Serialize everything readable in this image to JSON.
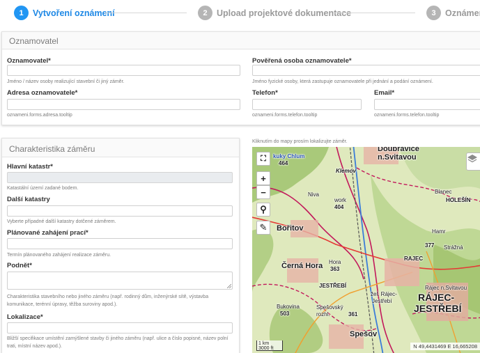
{
  "stepper": {
    "steps": [
      {
        "number": "1",
        "label": "Vytvoření oznámení"
      },
      {
        "number": "2",
        "label": "Upload projektové dokumentace"
      },
      {
        "number": "3",
        "label": "Oznámeno"
      }
    ]
  },
  "oznamovatel": {
    "title": "Oznamovatel",
    "fields": {
      "oznamovatel": {
        "label": "Oznamovatel*",
        "value": "",
        "help": "Jméno / název osoby realizující stavební či jiný záměr."
      },
      "poverena_osoba": {
        "label": "Pověřená osoba oznamovatele*",
        "value": "",
        "help": "Jméno fyzické osoby, která zastupuje oznamovatele při jednání a podání oznámení."
      },
      "adresa": {
        "label": "Adresa oznamovatele*",
        "value": "",
        "help": "oznameni.forms.adresa.tooltip"
      },
      "telefon": {
        "label": "Telefon*",
        "value": "",
        "help": "oznameni.forms.telefon.tooltip"
      },
      "email": {
        "label": "Email*",
        "value": "",
        "help": "oznameni.forms.telefon.tooltip"
      }
    }
  },
  "zamer": {
    "title": "Charakteristika záměru",
    "fields": {
      "hlavni_katastr": {
        "label": "Hlavní katastr*",
        "value": "",
        "help": "Katastální území zadané bodem."
      },
      "dalsi_katastry": {
        "label": "Další katastry",
        "value": "",
        "help": "Vyberte případné další katastry dotčené záměrem."
      },
      "zahajeni": {
        "label": "Plánované zahájení prací*",
        "value": "",
        "help": "Termín plánovaného zahájení realizace záměru."
      },
      "podnet": {
        "label": "Podnět*",
        "value": "",
        "help": "Charakteristika stavebního nebo jiného záměru (např. rodinný dům, inženýrské sítě, výstavba komunikace, terénní úpravy, těžba suroviny apod.)."
      },
      "lokalizace": {
        "label": "Lokalizace*",
        "value": "",
        "help": "Bližší specifikace umístění zamýšlené stavby či jiného záměru (např. ulice a číslo popisné, název polní trati, místní název apod.)."
      }
    }
  },
  "map": {
    "hint": "Kliknutím do mapy prosím lokalizujte záměr.",
    "controls": {
      "fullscreen": "⛶",
      "zoom_in": "+",
      "zoom_out": "−",
      "search": "⚲",
      "draw": "✎"
    },
    "places": {
      "doubravice": "Doubravice",
      "n_svitavou": "n.Svitavou",
      "kuky_chlum": "kuky Chlum",
      "kuky_chlum_num": "464",
      "kiemovi": "Klemov",
      "niva": "Niva",
      "work": "work",
      "n404": "404",
      "blanec": "Blanec",
      "holesin": "HOLEŠÍN",
      "boritov": "Bořitov",
      "cerna_hora": "Černá Hora",
      "hora": "Hora",
      "n363": "363",
      "rajec": "RAJEC",
      "hamr": "Hamr",
      "n377": "377",
      "strazna": "Strážná",
      "jestrebi": "JESTŘEBÍ",
      "rajec_jestrebi_a": "RÁJEC-",
      "rajec_jestrebi_b": "JESTŘEBÍ",
      "rajec_svitavou": "Rájec n.Svitavou",
      "bukovina": "Bukovina",
      "n503": "503",
      "spesovsk": "Spešovský",
      "rozhl": "rozhl.",
      "n361": "361",
      "zel_rajec": "žel. Rájec-",
      "zel_jestrebi": "Jestřebí",
      "spesov": "Spešov"
    },
    "scale_km": "1 km",
    "scale_ft": "3000 ft",
    "coords": "N 49,4431469 E 16,665208"
  },
  "colors": {
    "accent": "#2196f3",
    "inactive": "#b5b5b5"
  }
}
